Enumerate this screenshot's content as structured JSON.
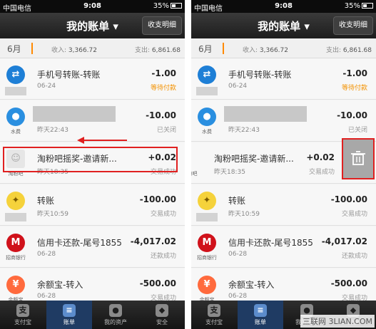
{
  "status": {
    "carrier": "中国电信",
    "time": "9:08",
    "battery": "35%"
  },
  "nav": {
    "title": "我的账单",
    "detail_button": "收支明细"
  },
  "summary": {
    "month": "6月",
    "income_label": "收入:",
    "income": "3,366.72",
    "expense_label": "支出:",
    "expense": "6,861.68"
  },
  "rows": [
    {
      "name": "手机号转账-转账",
      "date": "06-24",
      "amount": "-1.00",
      "status": "等待付款"
    },
    {
      "name": "",
      "date": "昨天22:43",
      "amount": "-10.00",
      "status": "已关闭",
      "icon_label": "水费"
    },
    {
      "name": "淘粉吧摇奖-邀请新...",
      "date": "昨天18:35",
      "amount": "+0.02",
      "status": "交易成功",
      "icon_label": "淘粉吧"
    },
    {
      "name": "转账",
      "date": "昨天10:59",
      "amount": "-100.00",
      "status": "交易成功"
    },
    {
      "name": "信用卡还款-尾号1855",
      "date": "06-28",
      "amount": "-4,017.02",
      "status": "还款成功",
      "icon_label": "招商银行"
    },
    {
      "name": "余额宝-转入",
      "date": "06-28",
      "amount": "-500.00",
      "status": "交易成功",
      "icon_label": "余额宝"
    }
  ],
  "tabs": [
    {
      "label": "支付宝",
      "icon": "alipay-icon"
    },
    {
      "label": "账单",
      "icon": "bill-icon"
    },
    {
      "label": "我的资产",
      "icon": "assets-icon"
    },
    {
      "label": "安全",
      "icon": "shield-icon"
    }
  ],
  "watermark": "三联网 3LIAN.COM",
  "colors": {
    "accent": "#f39200",
    "highlight": "#e02020",
    "nav": "#1d1d1d",
    "tab_active": "#1f3b63"
  }
}
